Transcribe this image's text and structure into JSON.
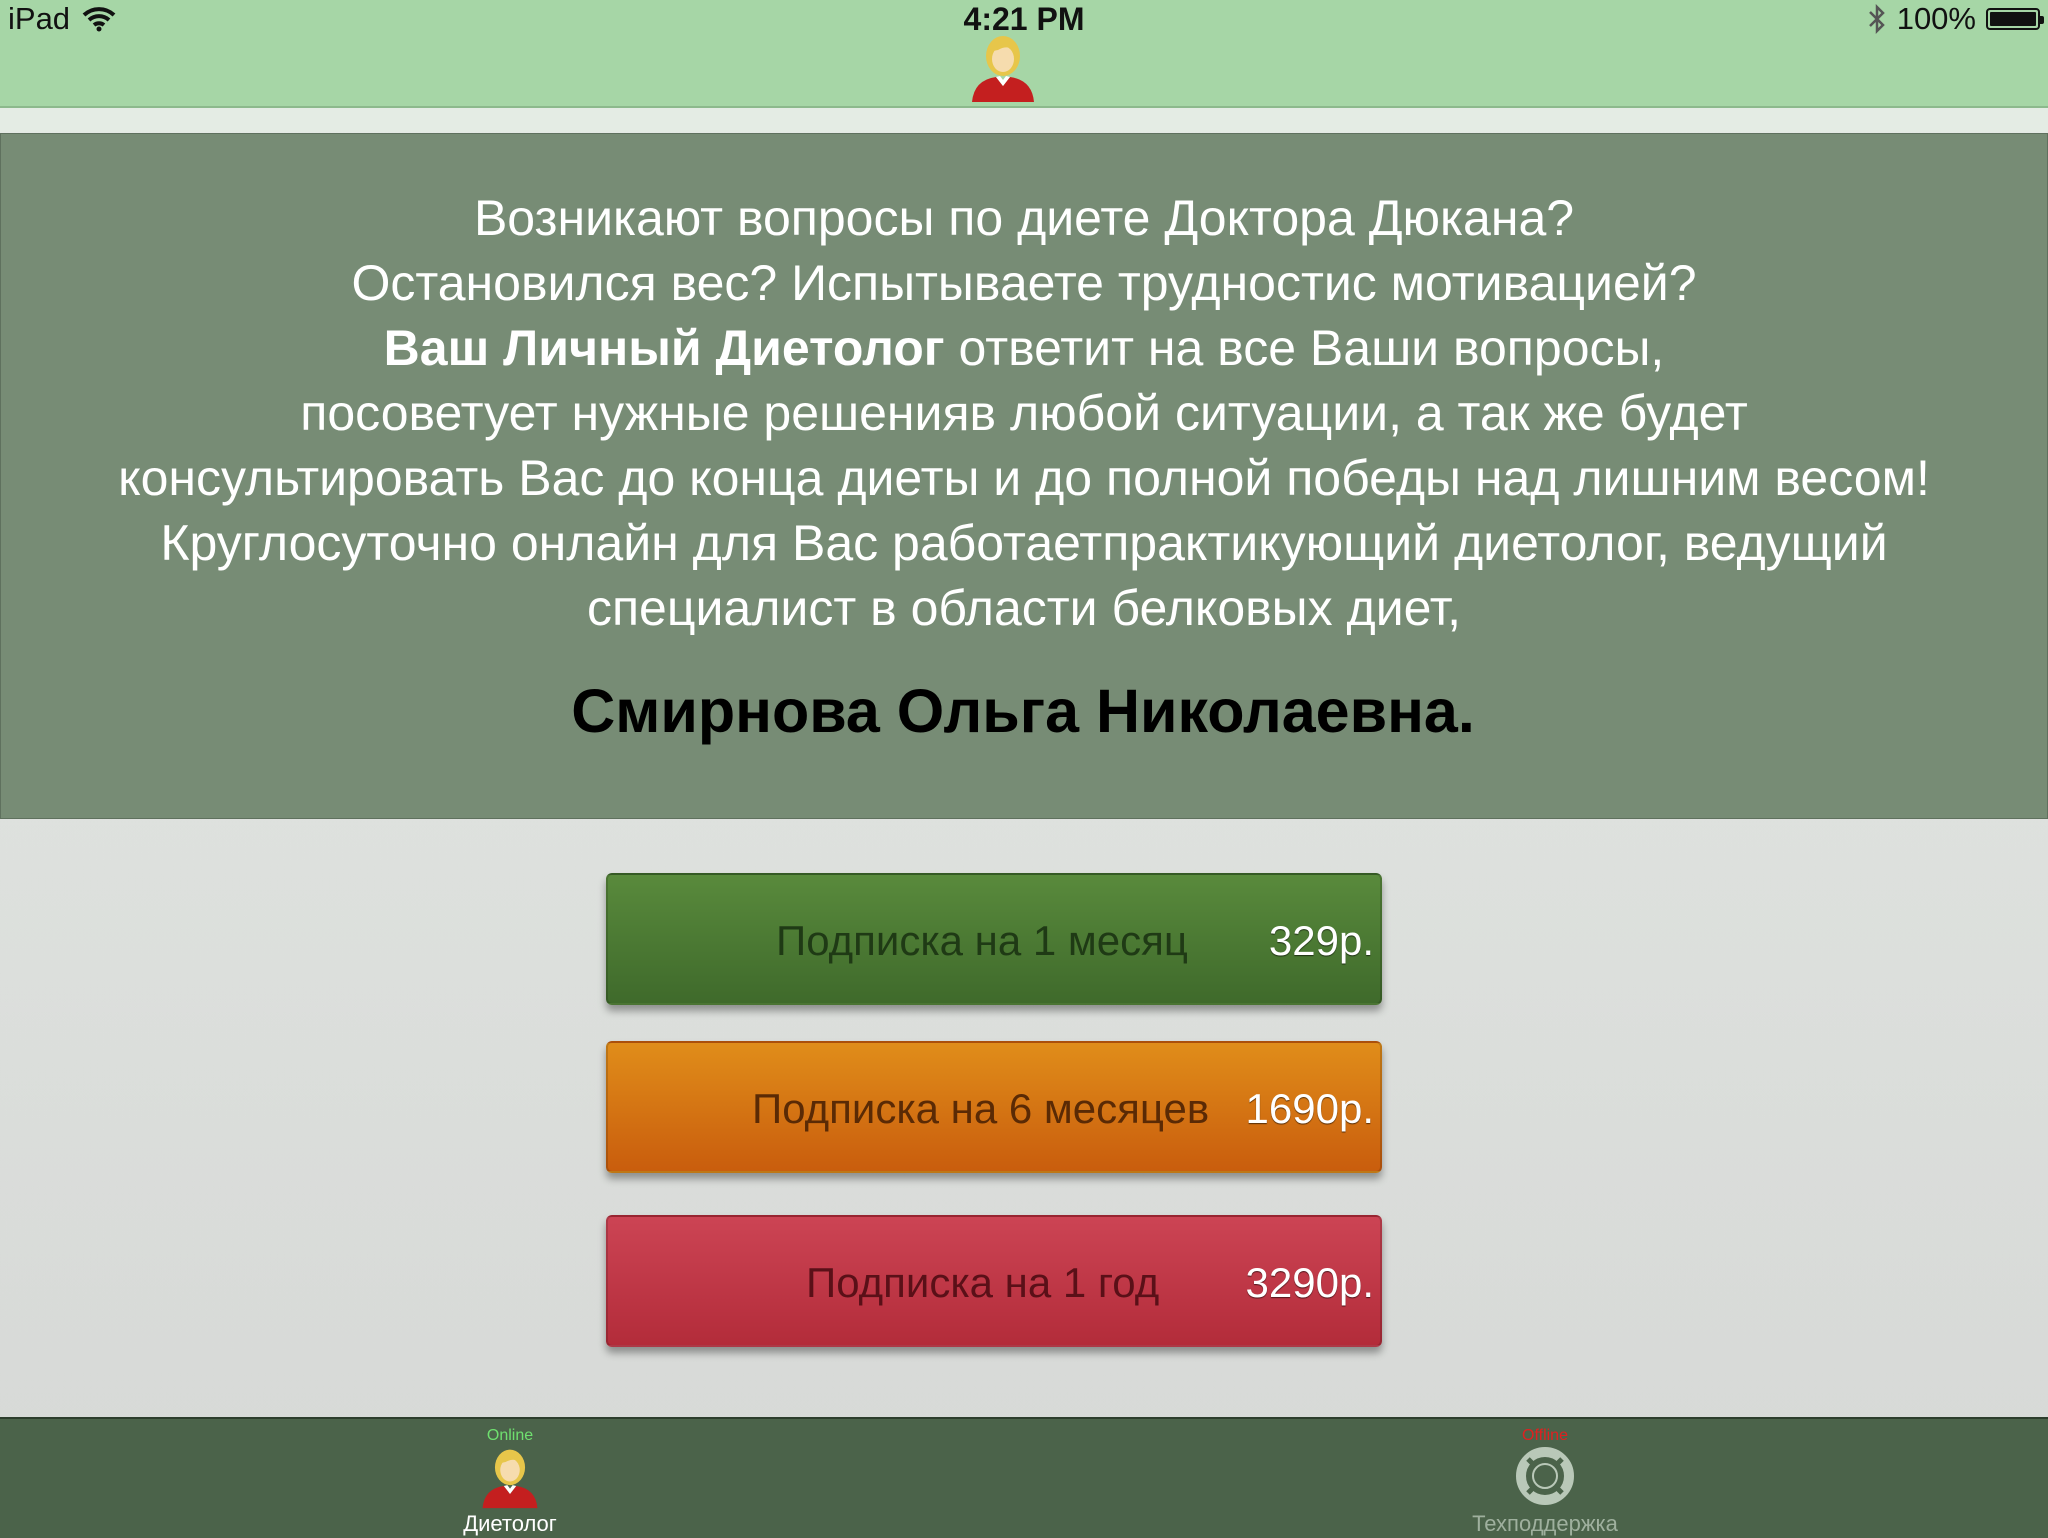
{
  "status_bar": {
    "device": "iPad",
    "time": "4:21 PM",
    "battery": "100%"
  },
  "info": {
    "line1": "Возникают вопросы по диете Доктора Дюкана?",
    "line2": "Остановился вес? Испытываете трудностис мотивацией?",
    "line3_bold": "Ваш Личный Диетолог",
    "line3_rest": " ответит на все Ваши вопросы,",
    "line4": "посоветует нужные решенияв любой ситуации, а так же будет",
    "line5": "консультировать Вас до конца диеты и до полной победы над лишним весом!",
    "line6": "Круглосуточно онлайн для Вас работаетпрактикующий диетолог, ведущий",
    "line7": "специалист в области белковых диет,",
    "name": "Смирнова Ольга Николаевна."
  },
  "subscriptions": [
    {
      "label": "Подписка на 1 месяц",
      "price": "329р.",
      "color": "#4f7c35"
    },
    {
      "label": "Подписка на 6 месяцев",
      "price": "1690р.",
      "color": "#d97514"
    },
    {
      "label": "Подписка на 1 год",
      "price": "3290р.",
      "color": "#c03a49"
    }
  ],
  "tabs": [
    {
      "status": "Online",
      "label": "Диетолог",
      "icon": "dietitian-avatar-icon"
    },
    {
      "status": "Offline",
      "label": "Техподдержка",
      "icon": "lifebuoy-icon"
    }
  ],
  "colors": {
    "header_bg": "#a6d6a6",
    "panel_bg": "#778c75",
    "tabbar_bg": "#4b634a",
    "online": "#6fe06f",
    "offline": "#e02020"
  }
}
